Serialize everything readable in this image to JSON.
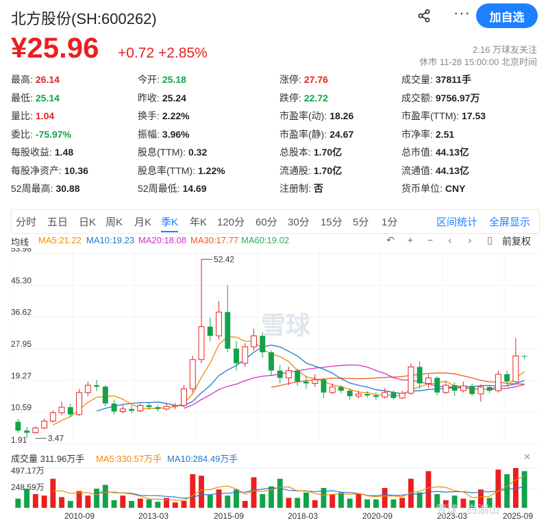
{
  "header": {
    "title": "北方股份(SH:600262)",
    "more_label": "···",
    "add_label": "加自选"
  },
  "quote": {
    "price": "¥25.96",
    "change": "+0.72",
    "change_pct": "+2.85%",
    "followers": "2.16 万球友关注",
    "status": "休市 11-28 15:00:00 北京时间"
  },
  "stats": [
    {
      "label": "最高:",
      "value": "26.14",
      "tone": "up"
    },
    {
      "label": "今开:",
      "value": "25.18",
      "tone": "down"
    },
    {
      "label": "涨停:",
      "value": "27.76",
      "tone": "up"
    },
    {
      "label": "成交量:",
      "value": "37811手",
      "tone": "neu"
    },
    {
      "label": "最低:",
      "value": "25.14",
      "tone": "down"
    },
    {
      "label": "昨收:",
      "value": "25.24",
      "tone": "neu"
    },
    {
      "label": "跌停:",
      "value": "22.72",
      "tone": "down"
    },
    {
      "label": "成交额:",
      "value": "9756.97万",
      "tone": "neu"
    },
    {
      "label": "量比:",
      "value": "1.04",
      "tone": "up"
    },
    {
      "label": "换手:",
      "value": "2.22%",
      "tone": "neu"
    },
    {
      "label": "市盈率(动):",
      "value": "18.26",
      "tone": "neu"
    },
    {
      "label": "市盈率(TTM):",
      "value": "17.53",
      "tone": "neu"
    },
    {
      "label": "委比:",
      "value": "-75.97%",
      "tone": "down"
    },
    {
      "label": "振幅:",
      "value": "3.96%",
      "tone": "neu"
    },
    {
      "label": "市盈率(静):",
      "value": "24.67",
      "tone": "neu"
    },
    {
      "label": "市净率:",
      "value": "2.51",
      "tone": "neu"
    },
    {
      "label": "每股收益:",
      "value": "1.48",
      "tone": "neu"
    },
    {
      "label": "股息(TTM):",
      "value": "0.32",
      "tone": "neu"
    },
    {
      "label": "总股本:",
      "value": "1.70亿",
      "tone": "neu"
    },
    {
      "label": "总市值:",
      "value": "44.13亿",
      "tone": "neu"
    },
    {
      "label": "每股净资产:",
      "value": "10.36",
      "tone": "neu"
    },
    {
      "label": "股息率(TTM):",
      "value": "1.22%",
      "tone": "neu"
    },
    {
      "label": "流通股:",
      "value": "1.70亿",
      "tone": "neu"
    },
    {
      "label": "流通值:",
      "value": "44.13亿",
      "tone": "neu"
    },
    {
      "label": "52周最高:",
      "value": "30.88",
      "tone": "neu"
    },
    {
      "label": "52周最低:",
      "value": "14.69",
      "tone": "neu"
    },
    {
      "label": "注册制:",
      "value": "否",
      "tone": "neu"
    },
    {
      "label": "货币单位:",
      "value": "CNY",
      "tone": "neu"
    }
  ],
  "tabs": [
    "分时",
    "五日",
    "日K",
    "周K",
    "月K",
    "季K",
    "年K",
    "120分",
    "60分",
    "30分",
    "15分",
    "5分",
    "1分"
  ],
  "active_tab": "季K",
  "tab_actions": [
    "区间统计",
    "全屏显示"
  ],
  "ma": {
    "label": "均线",
    "ma5": "MA5:21.22",
    "ma10": "MA10:19.23",
    "ma20": "MA20:18.08",
    "ma30": "MA30:17.77",
    "ma60": "MA60:19.02",
    "adjust": "前复权"
  },
  "volume": {
    "label": "成交量 311.96万手",
    "ma5": "MA5:330.57万手",
    "ma10": "MA10:284.49万手"
  },
  "colors": {
    "up": "#eb1f1f",
    "down": "#12a34a",
    "accent": "#1d80ff",
    "ma5": "#f08a00",
    "ma10": "#1f77d0",
    "ma20": "#d62ec0",
    "ma30": "#f05a1e",
    "ma60": "#21b35a"
  },
  "watermark": "雪球",
  "credit": "雪球 : 白湖山",
  "chart_data": {
    "type": "candlestick",
    "y_ticks": [
      "53.98",
      "45.30",
      "36.62",
      "27.95",
      "19.27",
      "10.59",
      "1.91"
    ],
    "x_ticks": [
      "2010-09",
      "2013-03",
      "2015-09",
      "2018-03",
      "2020-09",
      "2023-03",
      "2025-09"
    ],
    "price_range": [
      1.91,
      53.98
    ],
    "annotations": [
      {
        "text": "52.42",
        "value": 52.42,
        "index": 21
      },
      {
        "text": "3.47",
        "value": 3.47,
        "index": 2
      }
    ],
    "candles": [
      [
        8.0,
        5.6,
        8.8,
        5.0
      ],
      [
        5.6,
        5.0,
        6.6,
        3.47
      ],
      [
        5.0,
        6.3,
        6.8,
        4.8
      ],
      [
        6.3,
        8.2,
        8.8,
        6.0
      ],
      [
        8.2,
        10.5,
        11.2,
        7.8
      ],
      [
        10.5,
        12.0,
        13.5,
        9.8
      ],
      [
        12.0,
        10.0,
        13.0,
        9.2
      ],
      [
        10.0,
        16.0,
        17.0,
        9.6
      ],
      [
        16.0,
        18.0,
        19.0,
        15.0
      ],
      [
        18.0,
        17.6,
        19.5,
        16.4
      ],
      [
        17.6,
        13.0,
        18.0,
        12.2
      ],
      [
        13.0,
        10.8,
        14.0,
        10.0
      ],
      [
        10.8,
        11.5,
        12.6,
        10.2
      ],
      [
        11.5,
        11.0,
        12.4,
        10.4
      ],
      [
        11.0,
        12.5,
        13.0,
        10.6
      ],
      [
        12.5,
        12.0,
        13.2,
        11.2
      ],
      [
        12.0,
        11.5,
        12.6,
        10.8
      ],
      [
        11.5,
        12.2,
        13.0,
        11.0
      ],
      [
        12.2,
        12.5,
        13.2,
        11.5
      ],
      [
        12.5,
        17.0,
        18.0,
        12.0
      ],
      [
        17.0,
        25.0,
        26.0,
        16.0
      ],
      [
        25.0,
        34.0,
        52.42,
        24.0
      ],
      [
        34.0,
        31.5,
        36.5,
        30.0
      ],
      [
        31.5,
        38.0,
        41.0,
        30.5
      ],
      [
        38.0,
        28.0,
        45.3,
        27.0
      ],
      [
        28.0,
        24.0,
        30.0,
        22.0
      ],
      [
        24.0,
        28.5,
        29.5,
        23.0
      ],
      [
        28.5,
        31.5,
        33.5,
        27.5
      ],
      [
        31.5,
        27.0,
        32.5,
        25.5
      ],
      [
        27.0,
        22.0,
        27.5,
        20.5
      ],
      [
        22.0,
        20.0,
        23.5,
        18.5
      ],
      [
        20.0,
        22.0,
        23.0,
        18.0
      ],
      [
        22.0,
        19.0,
        22.5,
        17.8
      ],
      [
        19.0,
        18.5,
        20.5,
        17.0
      ],
      [
        18.5,
        19.5,
        21.0,
        17.5
      ],
      [
        19.5,
        16.0,
        20.0,
        14.5
      ],
      [
        16.0,
        17.5,
        18.5,
        15.5
      ],
      [
        17.5,
        16.5,
        18.0,
        15.8
      ],
      [
        16.5,
        15.0,
        17.0,
        14.0
      ],
      [
        15.0,
        15.6,
        16.5,
        14.4
      ],
      [
        15.6,
        15.2,
        16.4,
        14.6
      ],
      [
        15.2,
        14.8,
        16.0,
        14.0
      ],
      [
        14.8,
        16.0,
        17.2,
        14.4
      ],
      [
        16.0,
        14.5,
        16.6,
        14.0
      ],
      [
        14.5,
        15.8,
        16.5,
        14.2
      ],
      [
        15.8,
        23.0,
        24.0,
        15.4
      ],
      [
        23.0,
        18.5,
        24.5,
        17.0
      ],
      [
        18.5,
        20.0,
        21.0,
        17.2
      ],
      [
        20.0,
        16.0,
        20.4,
        15.2
      ],
      [
        16.0,
        18.0,
        19.0,
        15.6
      ],
      [
        18.0,
        16.5,
        18.8,
        15.0
      ],
      [
        16.5,
        17.8,
        19.0,
        16.0
      ],
      [
        17.8,
        15.6,
        18.4,
        15.0
      ],
      [
        15.6,
        17.5,
        18.2,
        13.5
      ],
      [
        17.5,
        16.5,
        18.0,
        15.8
      ],
      [
        16.5,
        21.0,
        22.0,
        16.0
      ],
      [
        21.0,
        19.0,
        22.0,
        18.2
      ],
      [
        19.0,
        26.0,
        30.88,
        18.6
      ],
      [
        26.0,
        25.96,
        26.14,
        25.14
      ]
    ],
    "volumes": [
      120,
      250,
      180,
      160,
      380,
      140,
      90,
      220,
      160,
      250,
      300,
      100,
      160,
      90,
      120,
      110,
      80,
      130,
      70,
      90,
      440,
      420,
      170,
      240,
      160,
      240,
      90,
      400,
      180,
      280,
      380,
      130,
      130,
      200,
      100,
      260,
      180,
      200,
      120,
      180,
      110,
      110,
      260,
      110,
      130,
      380,
      200,
      480,
      180,
      100,
      160,
      120,
      100,
      240,
      130,
      500,
      440,
      520,
      480
    ],
    "ma_note": "MA lines computed from closes (periods 5,10,20,30,60); volume MA5 / MA10"
  }
}
